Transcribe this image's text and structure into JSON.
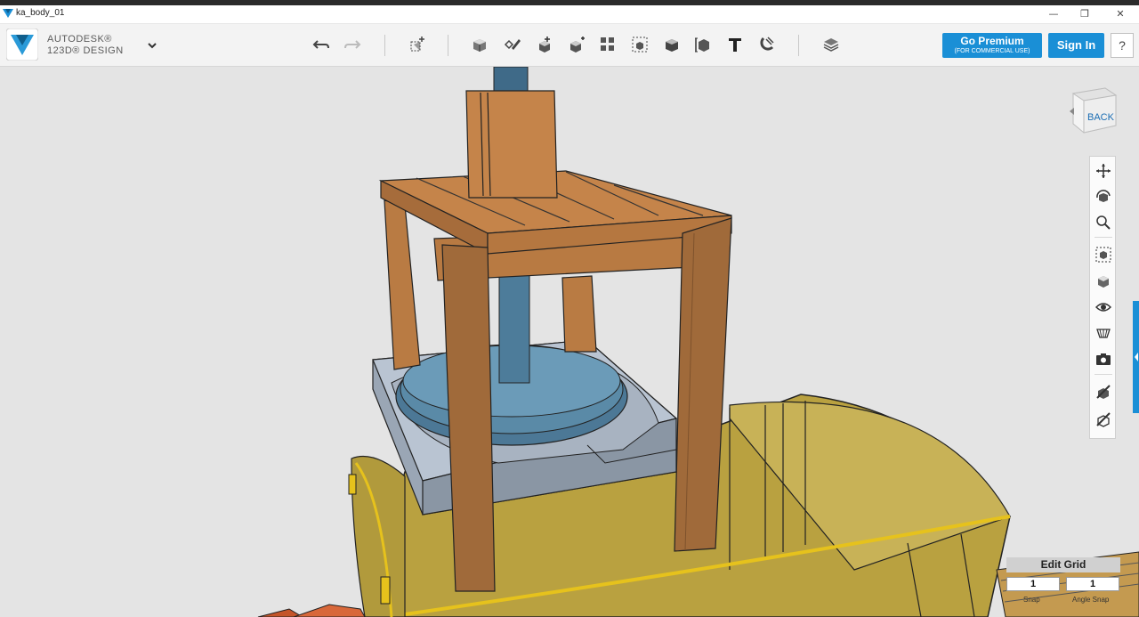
{
  "window": {
    "title": "ka_body_01",
    "minimize": "—",
    "restore": "❐",
    "close": "✕"
  },
  "brand": {
    "line1": "AUTODESK®",
    "line2": "123D® DESIGN"
  },
  "toolbar": {
    "tools": [
      {
        "name": "undo-icon"
      },
      {
        "name": "redo-icon"
      },
      {
        "name": "transform-icon"
      },
      {
        "name": "primitives-icon"
      },
      {
        "name": "sketch-icon"
      },
      {
        "name": "construct-icon"
      },
      {
        "name": "modify-icon"
      },
      {
        "name": "pattern-icon"
      },
      {
        "name": "grouping-icon"
      },
      {
        "name": "combine-icon"
      },
      {
        "name": "measure-icon"
      },
      {
        "name": "text-icon"
      },
      {
        "name": "snap-icon"
      },
      {
        "name": "materials-icon"
      }
    ]
  },
  "account": {
    "premium_label": "Go Premium",
    "premium_sub": "(FOR COMMERCIAL USE)",
    "signin_label": "Sign In",
    "help_label": "?"
  },
  "viewcube": {
    "face": "BACK"
  },
  "navbar": {
    "items": [
      "pan-icon",
      "orbit-icon",
      "zoom-icon",
      "fit-icon",
      "views-icon",
      "visibility-icon",
      "materials-outlines-icon",
      "screenshot-icon",
      "hide-icon",
      "show-icon"
    ]
  },
  "grid": {
    "title": "Edit Grid",
    "snap_value": "1",
    "angle_value": "1",
    "snap_label": "Snap",
    "angle_label": "Angle Snap"
  },
  "colors": {
    "accent": "#1a8fd6",
    "wood": "#c5844a",
    "wood_dark": "#a0683a",
    "tank": "#b9a140",
    "plate": "#a7b3c4",
    "press": "#5a8aa7"
  }
}
